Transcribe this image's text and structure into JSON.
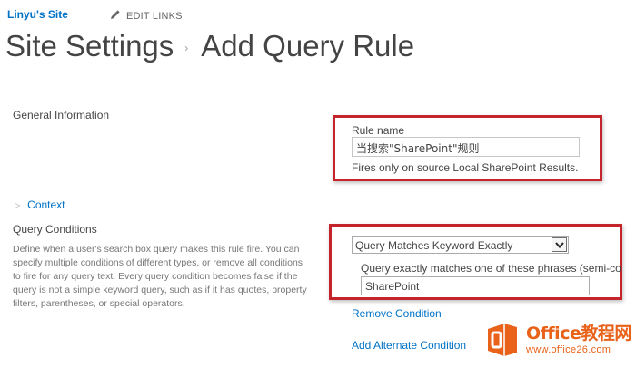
{
  "header": {
    "site_name": "Linyu's Site",
    "edit_links_label": "EDIT LINKS"
  },
  "title": {
    "part1": "Site Settings",
    "separator": "›",
    "part2": "Add Query Rule"
  },
  "general_information": {
    "label": "General Information",
    "rule_name_label": "Rule name",
    "rule_name_value": "当搜索\"SharePoint\"规则",
    "fires_note": "Fires only on source Local SharePoint Results."
  },
  "context": {
    "label": "Context"
  },
  "query_conditions": {
    "label": "Query Conditions",
    "description": "Define when a user's search box query makes this rule fire. You can specify multiple conditions of different types, or remove all conditions to fire for any query text. Every query condition becomes false if the query is not a simple keyword query, such as if it has quotes, property filters, parentheses, or special operators.",
    "condition_type_selected": "Query Matches Keyword Exactly",
    "phrases_label": "Query exactly matches one of these phrases (semi-co",
    "phrases_value": "SharePoint",
    "remove_condition": "Remove Condition",
    "add_alternate_condition": "Add Alternate Condition"
  },
  "watermark": {
    "brand": "Office教程网",
    "url": "www.office26.com"
  },
  "colors": {
    "link": "#0072c6",
    "highlight_box": "#c4242c",
    "watermark": "#e8621a"
  },
  "icons": {
    "edit": "pencil-icon",
    "expand": "triangle-right-icon",
    "dropdown": "chevron-down-icon",
    "logo": "office-logo-icon"
  }
}
